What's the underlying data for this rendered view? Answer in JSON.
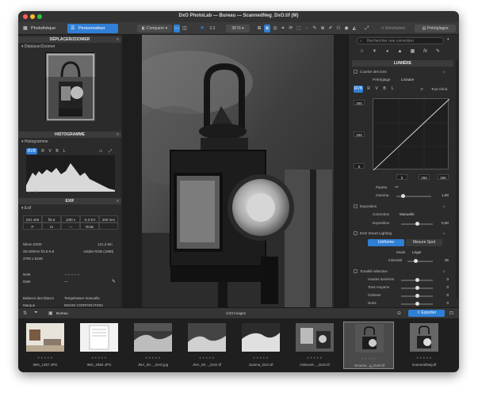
{
  "window": {
    "title": "DxO PhotoLab — Bureau — ScannedNeg_DxO.tif (M)"
  },
  "toolbar": {
    "tab_library": "Photothèque",
    "tab_customize": "Personnaliser",
    "compare_label": "Comparer",
    "zoom_ratio": "1:1",
    "zoom_percent": "30 %",
    "restore_label": "Réinitialiser",
    "presets_label": "Préréglages"
  },
  "left": {
    "move_zoom_header": "DÉPLACER/ZOOMER",
    "move_zoom_sub": "Déplacer/Zoomer",
    "histogram_header": "HISTOGRAMME",
    "histogram_sub": "Histogramme",
    "histo_channels": [
      "RVB",
      "R",
      "V",
      "B",
      "L"
    ],
    "exif_header": "EXIF",
    "exif_sub": "Exif",
    "exif_cells": [
      "ISO 400",
      "f/5.6",
      "1/80 s",
      "-0.3 EV",
      "200 mm",
      "P",
      "",
      "—",
      "RGB",
      ""
    ],
    "camera": "Nikon D200",
    "filesize": "121,3 Mo",
    "lens": "28-200mm f/3.5-5.6",
    "colorspace": "Adobe RGB (1998)",
    "dimensions": "3780 x 5346",
    "rows": [
      {
        "key": "Note",
        "value": ""
      },
      {
        "key": "Date",
        "value": "—"
      },
      {
        "key": "Balance des blancs",
        "value": "Température manuelle"
      },
      {
        "key": "Marque",
        "value": "NIKON CORPORATION"
      },
      {
        "key": "Boîtier",
        "value": "NIKON D200"
      }
    ]
  },
  "right": {
    "search_placeholder": "Rechercher une correction",
    "lumiere_header": "LUMIÈRE",
    "tone_curve": "Courbe des tons",
    "preset_label": "Préréglage",
    "preset_value": "Linéaire",
    "channels": [
      "RVB",
      "R",
      "V",
      "B",
      "L"
    ],
    "reset_all": "Tout réinit.",
    "curve_top": "255",
    "curve_mid": "255",
    "curve_bottom": "0",
    "curve_in0": "0",
    "curve_in255": "255",
    "curve_in255b": "255",
    "pipette": "Pipette",
    "gamma_label": "Gamma",
    "gamma_value": "1,00",
    "exposure_title": "Exposition",
    "correction_label": "Correction",
    "correction_value": "Manuelle",
    "exposure_label": "Exposition",
    "exposure_value": "0,00",
    "smart_lighting": "DxO Smart Lighting",
    "uniform": "Uniforme",
    "spot": "Mesure Spot",
    "mode_label": "Mode",
    "mode_value": "Léger",
    "intensity_label": "Intensité",
    "intensity_value": "25",
    "selective_tone": "Tonalité sélective",
    "hautes_lumieres": "Hautes lumières",
    "tons_moyens": "Tons moyens",
    "ombres": "Ombres",
    "noirs": "Noirs",
    "zero": "0"
  },
  "filmbar": {
    "folder": "Bureau",
    "count": "1/23 images",
    "export": "Exporter"
  },
  "thumbs": [
    {
      "name": "IMG_1357.JPG"
    },
    {
      "name": "IMG_2984.JPG"
    },
    {
      "name": "JNA_00..._DxO.jpg"
    },
    {
      "name": "JNA_00..._DxO.tif"
    },
    {
      "name": "Joanna_DxO.tif"
    },
    {
      "name": "Oskwork..._DxO.tif"
    },
    {
      "name": "Scanne...g_DxO.tif"
    },
    {
      "name": "ScannedNeg.tif"
    }
  ],
  "colors": {
    "accent": "#2f7fd6",
    "panel": "#2b2b2b",
    "header": "#3b3b3b"
  }
}
